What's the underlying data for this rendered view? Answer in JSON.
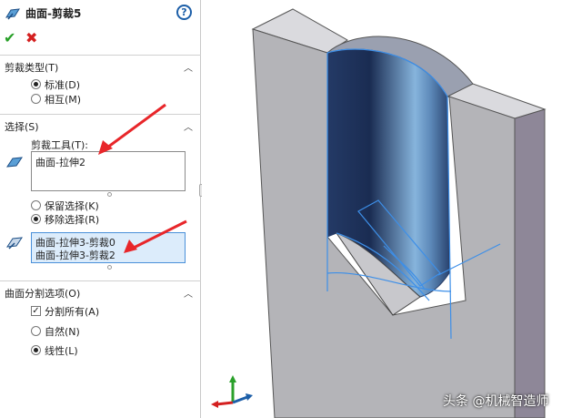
{
  "header": {
    "title": "曲面-剪裁5",
    "help_icon": "help-icon",
    "ok_icon": "check-icon",
    "cancel_icon": "close-icon"
  },
  "trim_type": {
    "title": "剪裁类型(T)",
    "options": [
      {
        "label": "标准(D)",
        "selected": true
      },
      {
        "label": "相互(M)",
        "selected": false
      }
    ]
  },
  "selections": {
    "title": "选择(S)",
    "trim_tool_label": "剪裁工具(T):",
    "trim_tool_value": "曲面-拉伸2",
    "keep_remove": [
      {
        "label": "保留选择(K)",
        "selected": false
      },
      {
        "label": "移除选择(R)",
        "selected": true
      }
    ],
    "pieces": [
      "曲面-拉伸3-剪裁0",
      "曲面-拉伸3-剪裁2"
    ]
  },
  "split_options": {
    "title": "曲面分割选项(O)",
    "split_all": {
      "label": "分割所有(A)",
      "checked": true
    },
    "options": [
      {
        "label": "自然(N)",
        "selected": false
      },
      {
        "label": "线性(L)",
        "selected": true
      }
    ]
  },
  "colors": {
    "annotation_arrow": "#e8262a",
    "part_face": "#b4b4b8",
    "part_side": "#8e8798",
    "surface_dark": "#1c2f58",
    "surface_highlight": "#7fb0de",
    "selection_edge": "#3d8fe8"
  },
  "watermark": "头条 @机械智造师"
}
